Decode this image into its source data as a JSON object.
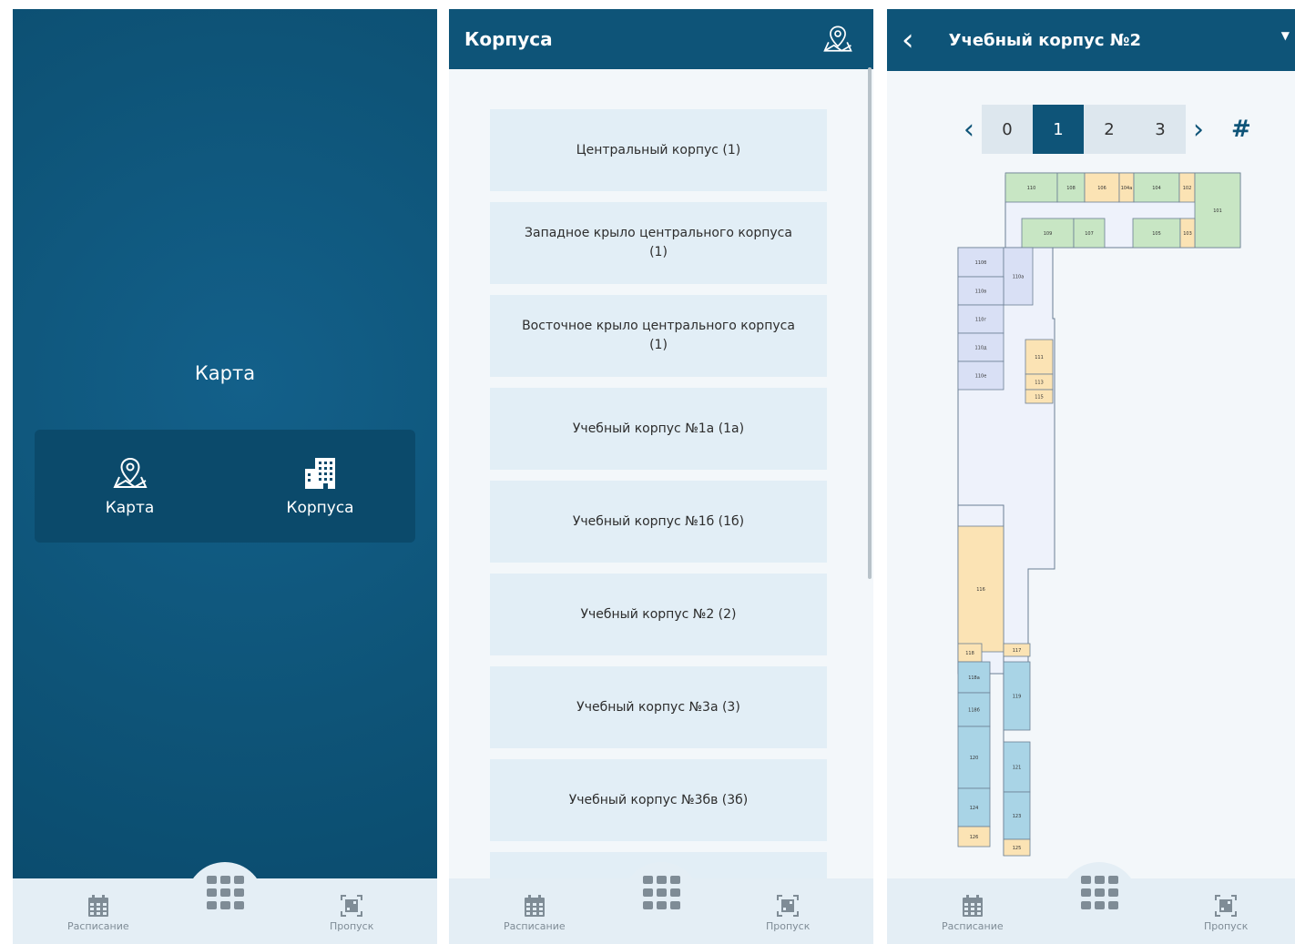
{
  "panel1": {
    "title": "Карта",
    "tiles": [
      {
        "label": "Карта",
        "icon": "map-pin-icon"
      },
      {
        "label": "Корпуса",
        "icon": "building-icon"
      }
    ]
  },
  "panel2": {
    "header_title": "Корпуса",
    "header_icon": "map-pin-icon",
    "buildings": [
      "Центральный корпус (1)",
      "Западное крыло центрального корпуса (1)",
      "Восточное крыло центрального корпуса (1)",
      "Учебный корпус №1а (1а)",
      "Учебный корпус №1б (1б)",
      "Учебный корпус №2 (2)",
      "Учебный корпус №3а (3)",
      "Учебный корпус №3бв (3б)"
    ]
  },
  "panel3": {
    "header_title": "Учебный корпус №2",
    "floors": [
      "0",
      "1",
      "2",
      "3"
    ],
    "active_floor": "1",
    "rooms": [
      "110",
      "108",
      "106",
      "104а",
      "104",
      "102",
      "101",
      "109",
      "107",
      "105",
      "103",
      "110б",
      "110а",
      "110в",
      "110г",
      "110д",
      "110е",
      "111",
      "113",
      "115",
      "116",
      "118",
      "117",
      "118а",
      "118б",
      "119",
      "120",
      "121",
      "124",
      "123",
      "126",
      "125"
    ]
  },
  "bottom_nav": {
    "schedule_label": "Расписание",
    "pass_label": "Пропуск",
    "menu_icon": "grid-menu-icon"
  },
  "colors": {
    "primary": "#0e5478",
    "tile_bg": "#e2eef6",
    "nav_bg": "#e4eef5",
    "room_green": "#c8e6c4",
    "room_yellow": "#fbe3b4",
    "room_blue": "#a9d4e6",
    "room_lavender": "#d9e0f5"
  }
}
